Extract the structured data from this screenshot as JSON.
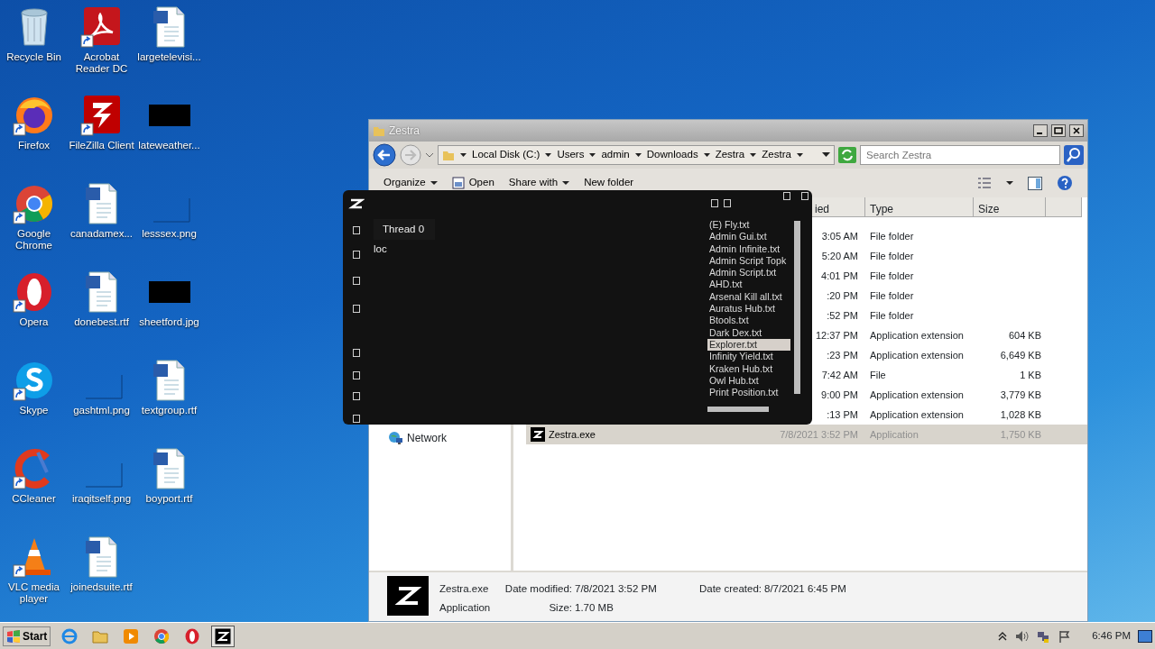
{
  "desktop_icons": [
    {
      "label": "Recycle Bin",
      "kind": "recycle",
      "shortcut": false
    },
    {
      "label": "Firefox",
      "kind": "firefox",
      "shortcut": true
    },
    {
      "label": "Google Chrome",
      "kind": "chrome",
      "shortcut": true
    },
    {
      "label": "Opera",
      "kind": "opera",
      "shortcut": true
    },
    {
      "label": "Skype",
      "kind": "skype",
      "shortcut": true
    },
    {
      "label": "CCleaner",
      "kind": "ccleaner",
      "shortcut": true
    },
    {
      "label": "VLC media player",
      "kind": "vlc",
      "shortcut": true
    },
    {
      "label": "Acrobat Reader DC",
      "kind": "pdf",
      "shortcut": true
    },
    {
      "label": "FileZilla Client",
      "kind": "filezilla",
      "shortcut": true
    },
    {
      "label": "canadamex...",
      "kind": "word",
      "shortcut": false
    },
    {
      "label": "donebest.rtf",
      "kind": "word",
      "shortcut": false
    },
    {
      "label": "gashtml.png",
      "kind": "blank",
      "shortcut": false
    },
    {
      "label": "iraqitself.png",
      "kind": "blank",
      "shortcut": false
    },
    {
      "label": "joinedsuite.rtf",
      "kind": "word",
      "shortcut": false
    },
    {
      "label": "largetelevisi...",
      "kind": "word",
      "shortcut": false
    },
    {
      "label": "lateweather...",
      "kind": "dark",
      "shortcut": false
    },
    {
      "label": "lesssex.png",
      "kind": "blank",
      "shortcut": false
    },
    {
      "label": "sheetford.jpg",
      "kind": "dark",
      "shortcut": false
    },
    {
      "label": "textgroup.rtf",
      "kind": "word",
      "shortcut": false
    },
    {
      "label": "boyport.rtf",
      "kind": "word",
      "shortcut": false
    }
  ],
  "explorer": {
    "title": "Zestra",
    "breadcrumbs": [
      "Local Disk (C:)",
      "Users",
      "admin",
      "Downloads",
      "Zestra",
      "Zestra"
    ],
    "search": {
      "placeholder": "Search Zestra"
    },
    "toolbar": [
      {
        "label": "Organize",
        "kind": "menu"
      },
      {
        "label": "Open",
        "kind": "open"
      },
      {
        "label": "Share with",
        "kind": "menu"
      },
      {
        "label": "New folder",
        "kind": "plain"
      }
    ],
    "columns": [
      "ied",
      "Type",
      "Size"
    ],
    "rows": [
      {
        "date": "3:05 AM",
        "type": "File folder",
        "selected": false
      },
      {
        "date": "5:20 AM",
        "type": "File folder",
        "selected": false
      },
      {
        "date": "4:01 PM",
        "type": "File folder",
        "selected": false
      },
      {
        "date": ":20 PM",
        "type": "File folder",
        "selected": false
      },
      {
        "date": ":52 PM",
        "type": "File folder",
        "selected": false
      },
      {
        "date": "12:37 PM",
        "type": "Application extension",
        "size": "604 KB",
        "selected": false
      },
      {
        "date": ":23 PM",
        "type": "Application extension",
        "size": "6,649 KB",
        "selected": false
      },
      {
        "date": "7:42 AM",
        "type": "File",
        "size": "1 KB",
        "selected": false
      },
      {
        "date": "9:00 PM",
        "type": "Application extension",
        "size": "3,779 KB",
        "selected": false
      },
      {
        "date": ":13 PM",
        "type": "Application extension",
        "size": "1,028 KB",
        "selected": false
      },
      {
        "name": "Zestra.exe",
        "date": "7/8/2021 3:52 PM",
        "type": "Application",
        "size": "1,750 KB",
        "selected": true
      }
    ],
    "sidebar": [
      {
        "label": "Network"
      }
    ],
    "details": {
      "name": "Zestra.exe",
      "type": "Application",
      "fields": [
        {
          "label": "Date modified:",
          "value": "7/8/2021 3:52 PM"
        },
        {
          "label": "Date created:",
          "value": "8/7/2021 6:45 PM"
        },
        {
          "label": "Size:",
          "value": "1.70 MB"
        }
      ]
    }
  },
  "zestra": {
    "tab": "Thread 0",
    "editor_text": "loc",
    "scripts": [
      {
        "label": "(E) Fly.txt",
        "selected": false
      },
      {
        "label": "Admin Gui.txt",
        "selected": false
      },
      {
        "label": "Admin Infinite.txt",
        "selected": false
      },
      {
        "label": "Admin Script Topk",
        "selected": false
      },
      {
        "label": "Admin Script.txt",
        "selected": false
      },
      {
        "label": "AHD.txt",
        "selected": false
      },
      {
        "label": "Arsenal Kill all.txt",
        "selected": false
      },
      {
        "label": "Auratus Hub.txt",
        "selected": false
      },
      {
        "label": "Btools.txt",
        "selected": false
      },
      {
        "label": "Dark Dex.txt",
        "selected": false
      },
      {
        "label": "Explorer.txt",
        "selected": true
      },
      {
        "label": "Infinity Yield.txt",
        "selected": false
      },
      {
        "label": "Kraken Hub.txt",
        "selected": false
      },
      {
        "label": "Owl Hub.txt",
        "selected": false
      },
      {
        "label": "Print Position.txt",
        "selected": false
      }
    ]
  },
  "taskbar": {
    "start": "Start",
    "apps": [
      {
        "kind": "ie",
        "selected": false
      },
      {
        "kind": "folder",
        "selected": false
      },
      {
        "kind": "media",
        "selected": false
      },
      {
        "kind": "chrome",
        "selected": false
      },
      {
        "kind": "opera",
        "selected": false
      },
      {
        "kind": "zestra",
        "selected": true
      }
    ],
    "clock": "6:46 PM"
  }
}
